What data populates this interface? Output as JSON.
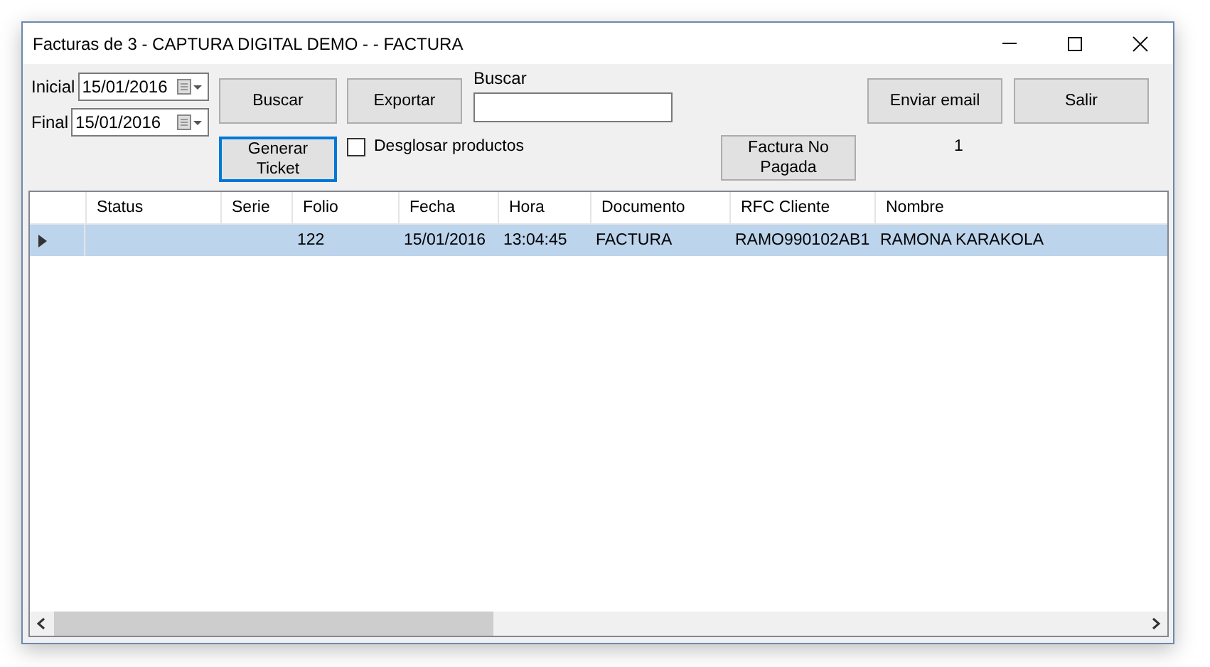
{
  "window": {
    "title": "Facturas de 3 - CAPTURA DIGITAL DEMO -  - FACTURA"
  },
  "date_filters": [
    {
      "label": "Inicial",
      "value": "15/01/2016"
    },
    {
      "label": "Final",
      "value": "15/01/2016"
    }
  ],
  "buttons": {
    "search": {
      "label": "Buscar",
      "focused": false
    },
    "export": {
      "label": "Exportar",
      "focused": false
    },
    "ticket": {
      "label": "Generar Ticket",
      "focused": true
    },
    "unpaid": {
      "label": "Factura No Pagada",
      "focused": false
    },
    "email": {
      "label": "Enviar email",
      "focused": false
    },
    "exit": {
      "label": "Salir",
      "focused": false
    }
  },
  "search": {
    "label": "Buscar"
  },
  "breakdown_checkbox": {
    "label": "Desglosar productos",
    "checked": false
  },
  "count": "1",
  "table": {
    "columns": [
      "Status",
      "Serie",
      "Folio",
      "Fecha",
      "Hora",
      "Documento",
      "RFC Cliente",
      "Nombre"
    ],
    "rows": [
      {
        "selected": true,
        "cells": [
          "",
          "",
          "122",
          "15/01/2016",
          "13:04:45",
          "FACTURA",
          "RAMO990102AB1",
          "RAMONA KARAKOLA"
        ]
      }
    ]
  }
}
